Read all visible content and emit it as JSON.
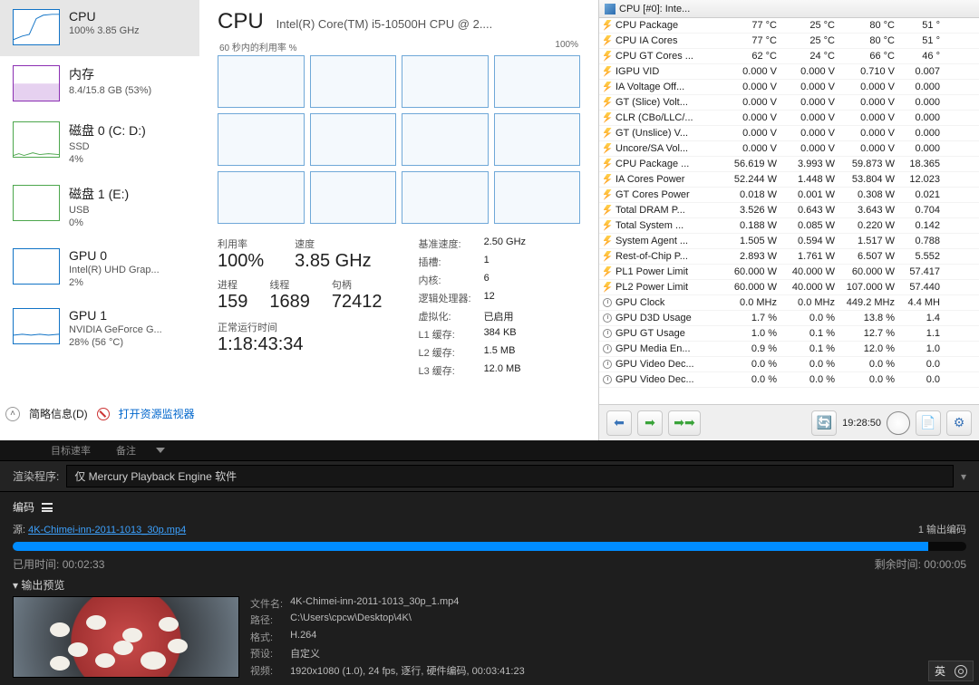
{
  "taskmgr": {
    "sidebar": [
      {
        "title": "CPU",
        "sub": "100% 3.85 GHz"
      },
      {
        "title": "内存",
        "sub": "8.4/15.8 GB (53%)"
      },
      {
        "title": "磁盘 0 (C: D:)",
        "sub": "SSD",
        "sub2": "4%"
      },
      {
        "title": "磁盘 1 (E:)",
        "sub": "USB",
        "sub2": "0%"
      },
      {
        "title": "GPU 0",
        "sub": "Intel(R) UHD Grap...",
        "sub2": "2%"
      },
      {
        "title": "GPU 1",
        "sub": "NVIDIA GeForce G...",
        "sub2": "28% (56 °C)"
      }
    ],
    "heading": "CPU",
    "model": "Intel(R) Core(TM) i5-10500H CPU @ 2....",
    "axis_left": "60 秒内的利用率 %",
    "axis_right": "100%",
    "stats": {
      "util_l": "利用率",
      "util_v": "100%",
      "speed_l": "速度",
      "speed_v": "3.85 GHz",
      "proc_l": "进程",
      "proc_v": "159",
      "thr_l": "线程",
      "thr_v": "1689",
      "hnd_l": "句柄",
      "hnd_v": "72412"
    },
    "kv": {
      "base_l": "基准速度:",
      "base_v": "2.50 GHz",
      "sock_l": "插槽:",
      "sock_v": "1",
      "core_l": "内核:",
      "core_v": "6",
      "lp_l": "逻辑处理器:",
      "lp_v": "12",
      "virt_l": "虚拟化:",
      "virt_v": "已启用",
      "l1_l": "L1 缓存:",
      "l1_v": "384 KB",
      "l2_l": "L2 缓存:",
      "l2_v": "1.5 MB",
      "l3_l": "L3 缓存:",
      "l3_v": "12.0 MB"
    },
    "uptime_l": "正常运行时间",
    "uptime_v": "1:18:43:34",
    "foot_brief": "简略信息(D)",
    "foot_resmon": "打开资源监视器"
  },
  "hwinfo": {
    "header": "CPU [#0]: Inte...",
    "rows": [
      {
        "ic": "b",
        "n": "CPU Package",
        "a": "77 °C",
        "b": "25 °C",
        "c": "80 °C",
        "d": "51 °"
      },
      {
        "ic": "b",
        "n": "CPU IA Cores",
        "a": "77 °C",
        "b": "25 °C",
        "c": "80 °C",
        "d": "51 °"
      },
      {
        "ic": "b",
        "n": "CPU GT Cores ...",
        "a": "62 °C",
        "b": "24 °C",
        "c": "66 °C",
        "d": "46 °"
      },
      {
        "ic": "b",
        "n": "IGPU VID",
        "a": "0.000 V",
        "b": "0.000 V",
        "c": "0.710 V",
        "d": "0.007"
      },
      {
        "ic": "b",
        "n": "IA Voltage Off...",
        "a": "0.000 V",
        "b": "0.000 V",
        "c": "0.000 V",
        "d": "0.000"
      },
      {
        "ic": "b",
        "n": "GT (Slice) Volt...",
        "a": "0.000 V",
        "b": "0.000 V",
        "c": "0.000 V",
        "d": "0.000"
      },
      {
        "ic": "b",
        "n": "CLR (CBo/LLC/...",
        "a": "0.000 V",
        "b": "0.000 V",
        "c": "0.000 V",
        "d": "0.000"
      },
      {
        "ic": "b",
        "n": "GT (Unslice) V...",
        "a": "0.000 V",
        "b": "0.000 V",
        "c": "0.000 V",
        "d": "0.000"
      },
      {
        "ic": "b",
        "n": "Uncore/SA Vol...",
        "a": "0.000 V",
        "b": "0.000 V",
        "c": "0.000 V",
        "d": "0.000"
      },
      {
        "ic": "b",
        "n": "CPU Package ...",
        "a": "56.619 W",
        "b": "3.993 W",
        "c": "59.873 W",
        "d": "18.365 "
      },
      {
        "ic": "b",
        "n": "IA Cores Power",
        "a": "52.244 W",
        "b": "1.448 W",
        "c": "53.804 W",
        "d": "12.023 "
      },
      {
        "ic": "b",
        "n": "GT Cores Power",
        "a": "0.018 W",
        "b": "0.001 W",
        "c": "0.308 W",
        "d": "0.021 "
      },
      {
        "ic": "b",
        "n": "Total DRAM P...",
        "a": "3.526 W",
        "b": "0.643 W",
        "c": "3.643 W",
        "d": "0.704 "
      },
      {
        "ic": "b",
        "n": "Total System ...",
        "a": "0.188 W",
        "b": "0.085 W",
        "c": "0.220 W",
        "d": "0.142 "
      },
      {
        "ic": "b",
        "n": "System Agent ...",
        "a": "1.505 W",
        "b": "0.594 W",
        "c": "1.517 W",
        "d": "0.788 "
      },
      {
        "ic": "b",
        "n": "Rest-of-Chip P...",
        "a": "2.893 W",
        "b": "1.761 W",
        "c": "6.507 W",
        "d": "5.552 "
      },
      {
        "ic": "b",
        "n": "PL1 Power Limit",
        "a": "60.000 W",
        "b": "40.000 W",
        "c": "60.000 W",
        "d": "57.417 "
      },
      {
        "ic": "b",
        "n": "PL2 Power Limit",
        "a": "60.000 W",
        "b": "40.000 W",
        "c": "107.000 W",
        "d": "57.440 "
      },
      {
        "ic": "c",
        "n": "GPU Clock",
        "a": "0.0 MHz",
        "b": "0.0 MHz",
        "c": "449.2 MHz",
        "d": "4.4 MH"
      },
      {
        "ic": "c",
        "n": "GPU D3D Usage",
        "a": "1.7 %",
        "b": "0.0 %",
        "c": "13.8 %",
        "d": "1.4 "
      },
      {
        "ic": "c",
        "n": "GPU GT Usage",
        "a": "1.0 %",
        "b": "0.1 %",
        "c": "12.7 %",
        "d": "1.1 "
      },
      {
        "ic": "c",
        "n": "GPU Media En...",
        "a": "0.9 %",
        "b": "0.1 %",
        "c": "12.0 %",
        "d": "1.0 "
      },
      {
        "ic": "c",
        "n": "GPU Video Dec...",
        "a": "0.0 %",
        "b": "0.0 %",
        "c": "0.0 %",
        "d": "0.0 "
      },
      {
        "ic": "c",
        "n": "GPU Video Dec...",
        "a": "0.0 %",
        "b": "0.0 %",
        "c": "0.0 %",
        "d": "0.0 "
      }
    ],
    "toolbar_time": "19:28:50"
  },
  "ame": {
    "tabs": [
      "目标速率",
      "备注"
    ],
    "render_l": "渲染程序:",
    "render_v": "仅 Mercury Playback Engine 软件",
    "encoding": "编码",
    "source_l": "源:",
    "source_v": "4K-Chimei-inn-2011-1013_30p.mp4",
    "out_count": "1 输出编码",
    "elapsed_l": "已用时间:",
    "elapsed_v": "00:02:33",
    "remain_l": "剩余时间:",
    "remain_v": "00:00:05",
    "outprev": "▾ 输出预览",
    "meta": {
      "file_l": "文件名:",
      "file_v": "4K-Chimei-inn-2011-1013_30p_1.mp4",
      "path_l": "路径:",
      "path_v": "C:\\Users\\cpcw\\Desktop\\4K\\",
      "fmt_l": "格式:",
      "fmt_v": "H.264",
      "preset_l": "预设:",
      "preset_v": "自定义",
      "video_l": "视频:",
      "video_v": "1920x1080 (1.0), 24 fps, 逐行, 硬件编码, 00:03:41:23"
    },
    "ime": "英"
  }
}
